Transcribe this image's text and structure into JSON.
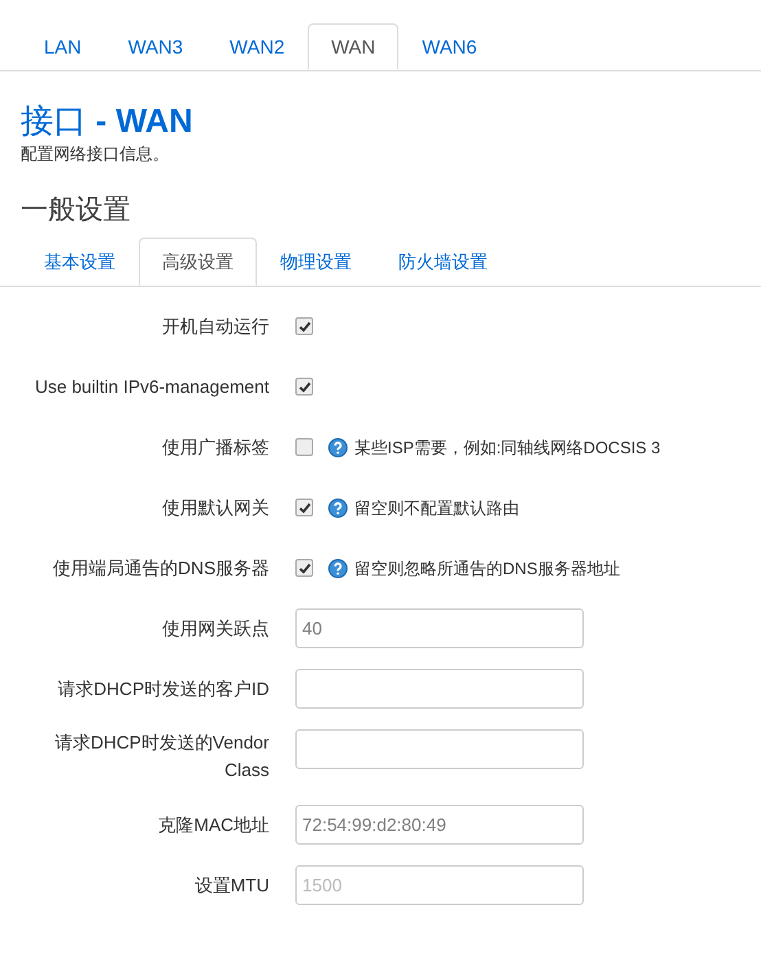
{
  "tabs": [
    {
      "label": "LAN",
      "selected": false
    },
    {
      "label": "WAN3",
      "selected": false
    },
    {
      "label": "WAN2",
      "selected": false
    },
    {
      "label": "WAN",
      "selected": true
    },
    {
      "label": "WAN6",
      "selected": false
    }
  ],
  "title": "接口 **- WAN**",
  "description": "配置网络接口信息。",
  "section_title": "一般设置",
  "section_tabs": [
    {
      "label": "基本设置",
      "selected": false
    },
    {
      "label": "高级设置",
      "selected": true
    },
    {
      "label": "物理设置",
      "selected": false
    },
    {
      "label": "防火墙设置",
      "selected": false
    }
  ],
  "fields": [
    {
      "kind": "checkbox",
      "label": "开机自动运行",
      "checked": true
    },
    {
      "kind": "checkbox",
      "label": "Use builtin IPv6-management",
      "checked": true
    },
    {
      "kind": "checkbox",
      "label": "使用广播标签",
      "checked": false,
      "help": "某些ISP需要，例如:同轴线网络DOCSIS 3"
    },
    {
      "kind": "checkbox",
      "label": "使用默认网关",
      "checked": true,
      "help": "留空则不配置默认路由"
    },
    {
      "kind": "checkbox",
      "label": "使用端局通告的DNS服务器",
      "checked": true,
      "help": "留空则忽略所通告的DNS服务器地址"
    },
    {
      "kind": "text",
      "label": "使用网关跃点",
      "value": "40"
    },
    {
      "kind": "text",
      "label": "请求DHCP时发送的客户ID"
    },
    {
      "kind": "text",
      "label": "请求DHCP时发送的Vendor Class"
    },
    {
      "kind": "text",
      "label": "克隆MAC地址",
      "value": "72:54:99:d2:80:49"
    },
    {
      "kind": "text",
      "label": "设置MTU",
      "placeholder": "1500"
    }
  ]
}
